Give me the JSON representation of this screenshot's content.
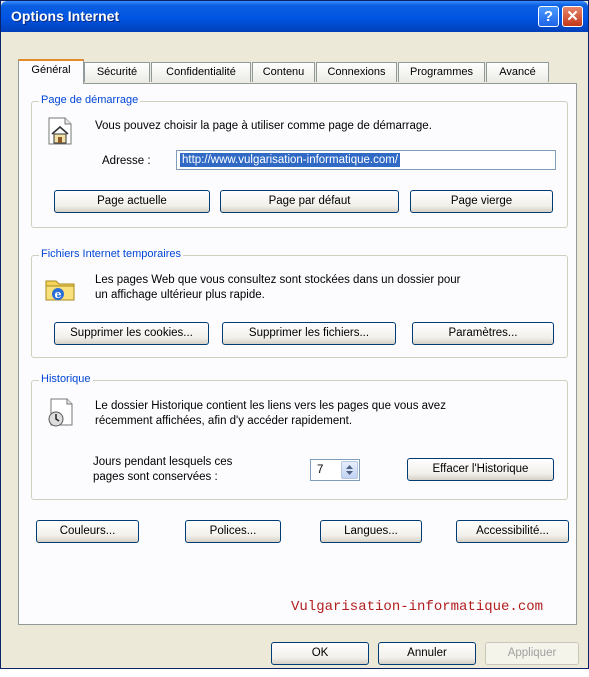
{
  "window": {
    "title": "Options Internet",
    "help_glyph": "?",
    "close_glyph": "✕"
  },
  "tabs": [
    {
      "label": "Général",
      "active": true
    },
    {
      "label": "Sécurité",
      "active": false
    },
    {
      "label": "Confidentialité",
      "active": false
    },
    {
      "label": "Contenu",
      "active": false
    },
    {
      "label": "Connexions",
      "active": false
    },
    {
      "label": "Programmes",
      "active": false
    },
    {
      "label": "Avancé",
      "active": false
    }
  ],
  "home_page": {
    "legend": "Page de démarrage",
    "icon": "house-page-icon",
    "description": "Vous pouvez choisir la page à utiliser comme page de démarrage.",
    "address_label": "Adresse :",
    "address_value": "http://www.vulgarisation-informatique.com/",
    "buttons": {
      "current": "Page actuelle",
      "default": "Page par défaut",
      "blank": "Page vierge"
    }
  },
  "temp_files": {
    "legend": "Fichiers Internet temporaires",
    "icon": "folder-ie-icon",
    "description_line1": "Les pages Web que vous consultez sont stockées dans un dossier pour",
    "description_line2": "un affichage ultérieur plus rapide.",
    "buttons": {
      "delete_cookies": "Supprimer les cookies...",
      "delete_files": "Supprimer les fichiers...",
      "settings": "Paramètres..."
    }
  },
  "history": {
    "legend": "Historique",
    "icon": "history-page-icon",
    "description_line1": "Le dossier Historique contient les liens vers les pages que vous avez",
    "description_line2": "récemment affichées, afin d'y accéder rapidement.",
    "days_label_line1": "Jours pendant lesquels ces",
    "days_label_line2": "pages sont conservées :",
    "days_value": "7",
    "clear_button": "Effacer l'Historique"
  },
  "bottom_buttons": {
    "colors": "Couleurs...",
    "fonts": "Polices...",
    "languages": "Langues...",
    "accessibility": "Accessibilité..."
  },
  "watermark": "Vulgarisation-informatique.com",
  "dialog_buttons": {
    "ok": "OK",
    "cancel": "Annuler",
    "apply": "Appliquer"
  },
  "colors": {
    "titlebar": "#0054e3",
    "legend_text": "#0046d5",
    "selection": "#316ac5",
    "watermark": "#b21e1e",
    "active_tab_accent": "#e68b2c"
  }
}
